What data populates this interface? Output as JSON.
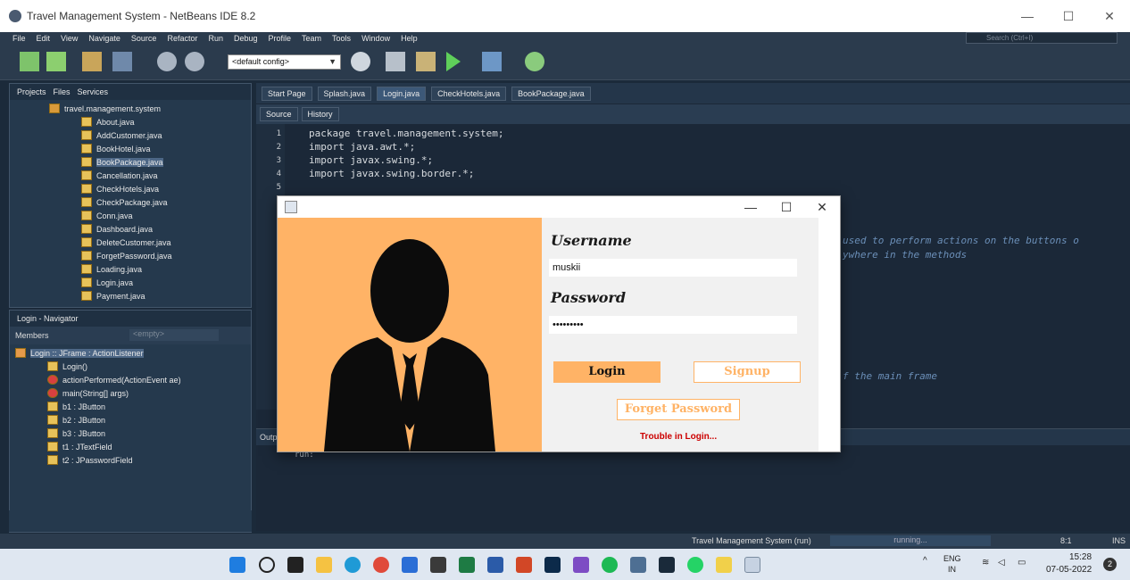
{
  "window": {
    "title": "Travel Management System - NetBeans IDE 8.2",
    "ctrl_min": "—",
    "ctrl_max": "☐",
    "ctrl_close": "✕"
  },
  "menu": [
    "File",
    "Edit",
    "View",
    "Navigate",
    "Source",
    "Refactor",
    "Run",
    "Debug",
    "Profile",
    "Team",
    "Tools",
    "Window",
    "Help"
  ],
  "search": {
    "placeholder": "Search (Ctrl+I)"
  },
  "toolbar": {
    "config": "<default config>"
  },
  "projects": {
    "tabs": [
      "Projects",
      "Files",
      "Services"
    ],
    "root": "travel.management.system",
    "files": [
      "About.java",
      "AddCustomer.java",
      "BookHotel.java",
      "BookPackage.java",
      "Cancellation.java",
      "CheckHotels.java",
      "CheckPackage.java",
      "Conn.java",
      "Dashboard.java",
      "DeleteCustomer.java",
      "ForgetPassword.java",
      "Loading.java",
      "Login.java",
      "Payment.java"
    ],
    "selected": "BookPackage.java"
  },
  "navigator": {
    "title": "Login - Navigator",
    "members_label": "Members",
    "filter": "<empty>",
    "root": "Login :: JFrame : ActionListener",
    "items": [
      "Login()",
      "actionPerformed(ActionEvent ae)",
      "main(String[] args)",
      "b1 : JButton",
      "b2 : JButton",
      "b3 : JButton",
      "t1 : JTextField",
      "t2 : JPasswordField"
    ]
  },
  "editor": {
    "tabs": [
      "Start Page",
      "Splash.java",
      "Login.java",
      "CheckHotels.java",
      "BookPackage.java"
    ],
    "active_tab": "Login.java",
    "source_tab": "Source",
    "history_tab": "History",
    "lines": [
      "package travel.management.system;",
      "",
      "import java.awt.*;",
      "import javax.swing.*;",
      "import javax.swing.border.*;"
    ],
    "line_numbers": [
      "1",
      "2",
      "3",
      "4",
      "5"
    ],
    "comment1": "used to perform actions on the buttons o",
    "comment2": "ywhere in the methods",
    "comment3": "f the main frame"
  },
  "output": {
    "tab": "Outp",
    "text": "run:"
  },
  "status": {
    "task": "Travel Management System (run)",
    "progress": "running...",
    "pos": "8:1",
    "mode": "INS"
  },
  "taskbar": {
    "lang": "ENG",
    "region": "IN",
    "time": "15:28",
    "date": "07-05-2022",
    "badge": "2"
  },
  "login": {
    "username_label": "Username",
    "username_value": "muskii",
    "password_label": "Password",
    "password_value": "•••••••••",
    "login_button": "Login",
    "signup_button": "Signup",
    "forget_button": "Forget Password",
    "trouble": "Trouble in Login...",
    "colors": {
      "panel": "#ffb366",
      "login_btn": "#ffb366",
      "trouble": "#cc0000"
    }
  }
}
